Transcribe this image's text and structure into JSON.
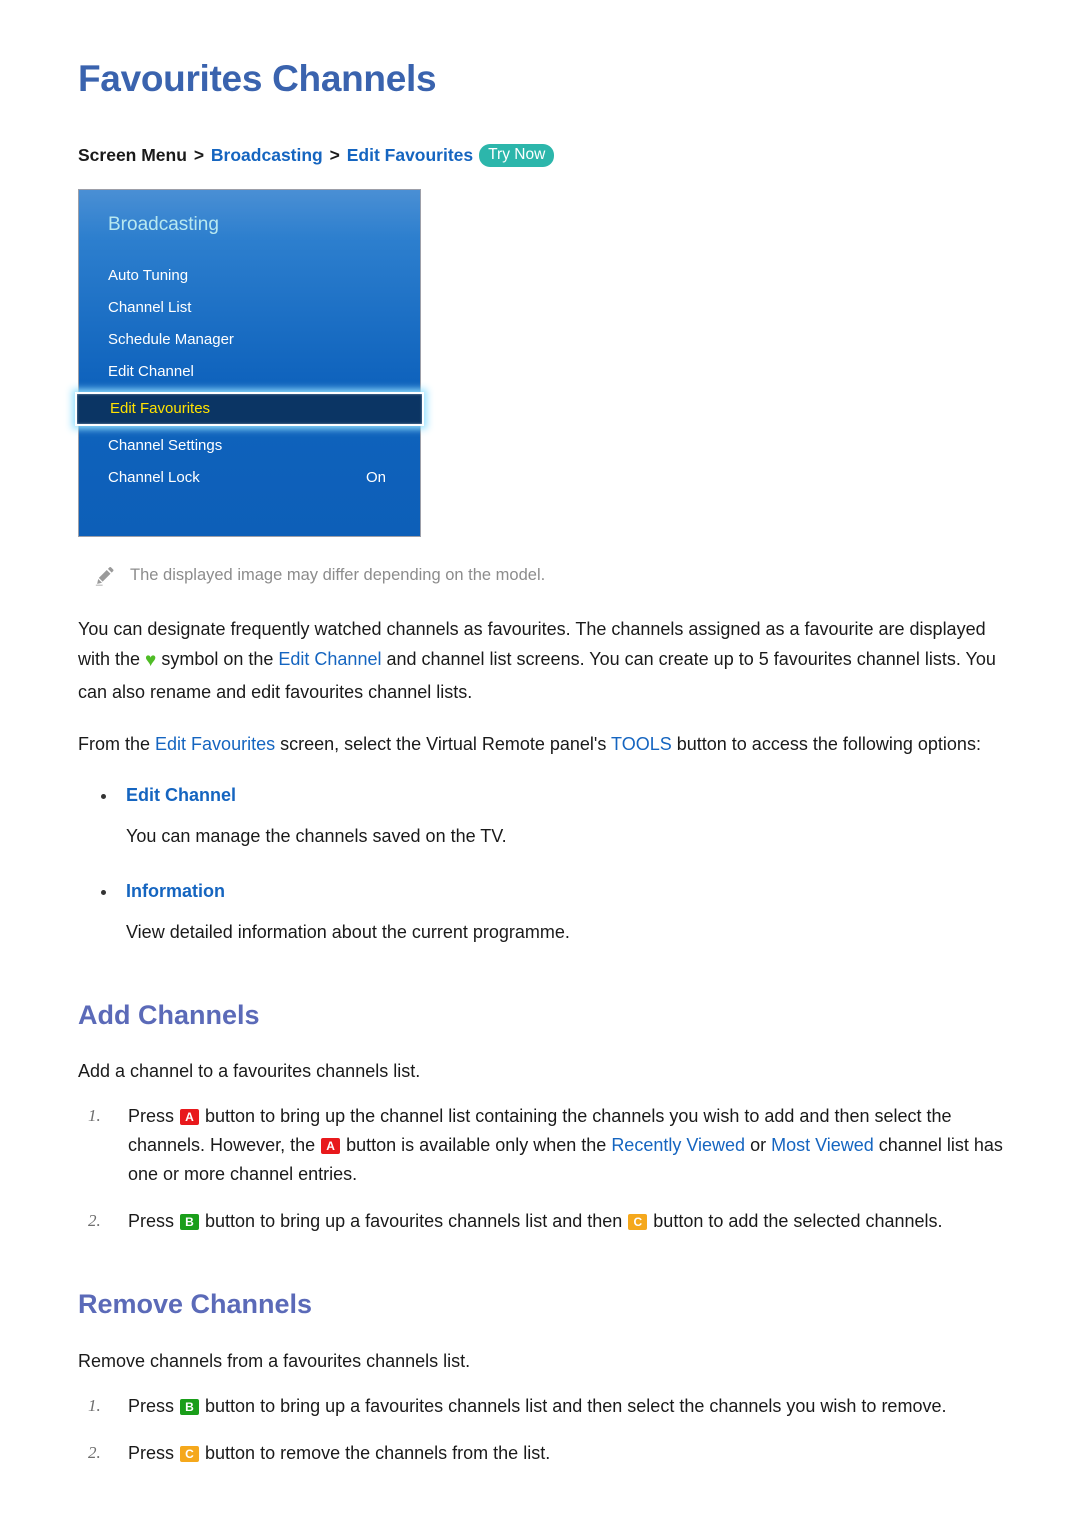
{
  "page": {
    "title": "Favourites Channels"
  },
  "breadcrumb": {
    "root": "Screen Menu",
    "sep": ">",
    "level2": "Broadcasting",
    "level3": "Edit Favourites",
    "try_now": "Try Now",
    "try_now_color": "#2cb6ab"
  },
  "tv_panel": {
    "header": "Broadcasting",
    "items": [
      {
        "label": "Auto Tuning",
        "value": "",
        "selected": false
      },
      {
        "label": "Channel List",
        "value": "",
        "selected": false
      },
      {
        "label": "Schedule Manager",
        "value": "",
        "selected": false
      },
      {
        "label": "Edit Channel",
        "value": "",
        "selected": false
      },
      {
        "label": "Edit Favourites",
        "value": "",
        "selected": true
      },
      {
        "label": "Channel Settings",
        "value": "",
        "selected": false
      },
      {
        "label": "Channel Lock",
        "value": "On",
        "selected": false
      }
    ],
    "selected_text_color": "#ffe200",
    "header_color": "#b8e8f0"
  },
  "note": {
    "icon": "pencil-icon",
    "text": "The displayed image may differ depending on the model."
  },
  "intro": {
    "p1_a": "You can designate frequently watched channels as favourites. The channels assigned as a favourite are displayed with the ",
    "p1_heart": "♥",
    "p1_b": " symbol on the ",
    "p1_link": "Edit Channel",
    "p1_c": " and channel list screens. You can create up to 5 favourites channel lists. You can also rename and edit favourites channel lists.",
    "p2_a": "From the ",
    "p2_link1": "Edit Favourites",
    "p2_b": " screen, select the Virtual Remote panel's ",
    "p2_link2": "TOOLS",
    "p2_c": " button to access the following options:"
  },
  "options": [
    {
      "title": "Edit Channel",
      "desc": "You can manage the channels saved on the TV."
    },
    {
      "title": "Information",
      "desc": "View detailed information about the current programme."
    }
  ],
  "add_channels": {
    "heading": "Add Channels",
    "intro": "Add a channel to a favourites channels list.",
    "step1": {
      "num": "1.",
      "a": "Press ",
      "key1": "A",
      "b": " button to bring up the channel list containing the channels you wish to add and then select the channels. However, the ",
      "key2": "A",
      "c": " button is available only when the ",
      "link1": "Recently Viewed",
      "d": " or ",
      "link2": "Most Viewed",
      "e": " channel list has one or more channel entries."
    },
    "step2": {
      "num": "2.",
      "a": "Press ",
      "key1": "B",
      "b": " button to bring up a favourites channels list and then ",
      "key2": "C",
      "c": " button to add the selected channels."
    }
  },
  "remove_channels": {
    "heading": "Remove Channels",
    "intro": "Remove channels from a favourites channels list.",
    "step1": {
      "num": "1.",
      "a": "Press ",
      "key1": "B",
      "b": " button to bring up a favourites channels list and then select the channels you wish to remove."
    },
    "step2": {
      "num": "2.",
      "a": "Press ",
      "key1": "C",
      "b": " button to remove the channels from the list."
    }
  },
  "colors": {
    "title_blue": "#3a63ae",
    "heading_purple": "#5b6ab8",
    "link_blue": "#1565c0",
    "key_a": "#e8191c",
    "key_b": "#1a9e1a",
    "key_c": "#f5a81c",
    "heart_green": "#4fbc26"
  }
}
